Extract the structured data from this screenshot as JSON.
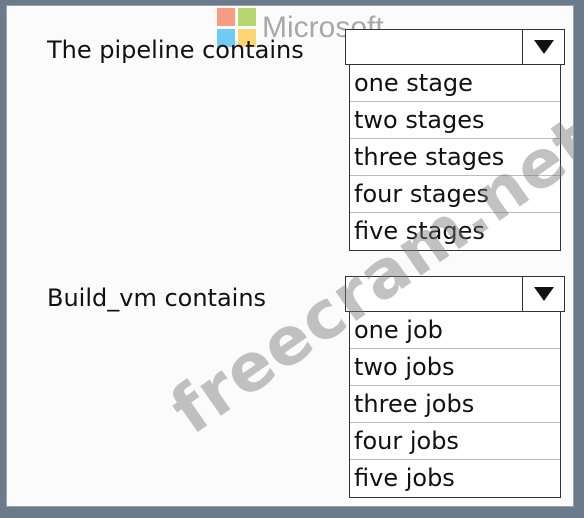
{
  "watermark_logo": {
    "text": "Microsoft",
    "colors": [
      "#f25022",
      "#7fba00",
      "#00a4ef",
      "#ffb900"
    ]
  },
  "watermark_text": "freecram.net",
  "questions": [
    {
      "label": "The pipeline contains",
      "selected": "",
      "options": [
        "one stage",
        "two stages",
        "three stages",
        "four stages",
        "five stages"
      ]
    },
    {
      "label": "Build_vm contains",
      "selected": "",
      "options": [
        "one job",
        "two jobs",
        "three jobs",
        "four jobs",
        "five jobs"
      ]
    }
  ],
  "icons": {
    "dropdown_arrow": "triangle-down-icon"
  }
}
